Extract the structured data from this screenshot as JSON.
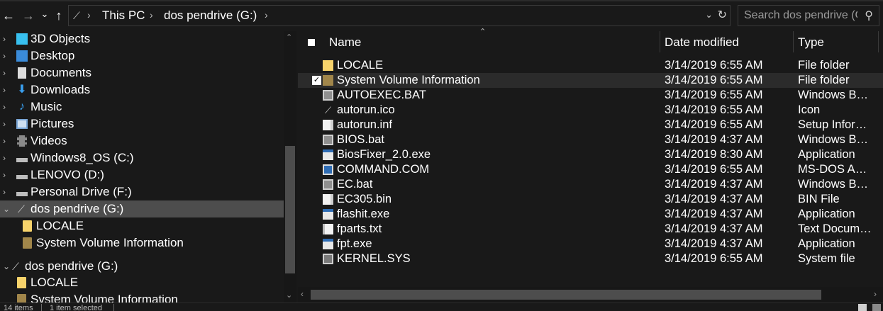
{
  "toolbar": {
    "back_glyph": "←",
    "forward_glyph": "→",
    "recent_glyph": "⌄",
    "up_glyph": "↑"
  },
  "address": {
    "breadcrumbs": [
      "This PC",
      "dos pendrive (G:)"
    ],
    "separator": "›",
    "dropdown_glyph": "⌄",
    "refresh_glyph": "↻"
  },
  "search": {
    "placeholder": "Search dos pendrive (G:)",
    "icon": "search-icon",
    "glyph": "⚲"
  },
  "nav": {
    "items": [
      {
        "label": "3D Objects",
        "icon": "3d-objects-icon"
      },
      {
        "label": "Desktop",
        "icon": "desktop-icon"
      },
      {
        "label": "Documents",
        "icon": "documents-icon"
      },
      {
        "label": "Downloads",
        "icon": "downloads-icon"
      },
      {
        "label": "Music",
        "icon": "music-icon"
      },
      {
        "label": "Pictures",
        "icon": "pictures-icon"
      },
      {
        "label": "Videos",
        "icon": "videos-icon"
      },
      {
        "label": "Windows8_OS (C:)",
        "icon": "drive-icon"
      },
      {
        "label": "LENOVO (D:)",
        "icon": "drive-icon"
      },
      {
        "label": "Personal Drive (F:)",
        "icon": "drive-icon"
      },
      {
        "label": "dos pendrive (G:)",
        "icon": "usb-drive-icon",
        "selected": true
      },
      {
        "label": "LOCALE",
        "icon": "folder-icon"
      },
      {
        "label": "System Volume Information",
        "icon": "folder-icon"
      },
      {
        "label": "dos pendrive (G:)",
        "icon": "usb-drive-icon"
      },
      {
        "label": "LOCALE",
        "icon": "folder-icon"
      },
      {
        "label": "System Volume Information",
        "icon": "folder-icon"
      }
    ],
    "collapsed_glyph": "›",
    "expanded_glyph": "⌄"
  },
  "columns": {
    "name": "Name",
    "date": "Date modified",
    "type": "Type"
  },
  "files": [
    {
      "name": "LOCALE",
      "date": "3/14/2019 6:55 AM",
      "type": "File folder",
      "icon": "folder-icon"
    },
    {
      "name": "System Volume Information",
      "date": "3/14/2019 6:55 AM",
      "type": "File folder",
      "icon": "folder-icon",
      "checked": true
    },
    {
      "name": "AUTOEXEC.BAT",
      "date": "3/14/2019 6:55 AM",
      "type": "Windows Batch File",
      "icon": "batch-file-icon"
    },
    {
      "name": "autorun.ico",
      "date": "3/14/2019 6:55 AM",
      "type": "Icon",
      "icon": "icon-file-icon"
    },
    {
      "name": "autorun.inf",
      "date": "3/14/2019 6:55 AM",
      "type": "Setup Information",
      "icon": "setup-info-icon"
    },
    {
      "name": "BIOS.bat",
      "date": "3/14/2019 4:37 AM",
      "type": "Windows Batch File",
      "icon": "batch-file-icon"
    },
    {
      "name": "BiosFixer_2.0.exe",
      "date": "3/14/2019 8:30 AM",
      "type": "Application",
      "icon": "application-icon"
    },
    {
      "name": "COMMAND.COM",
      "date": "3/14/2019 6:55 AM",
      "type": "MS-DOS Application",
      "icon": "msdos-app-icon"
    },
    {
      "name": "EC.bat",
      "date": "3/14/2019 4:37 AM",
      "type": "Windows Batch File",
      "icon": "batch-file-icon"
    },
    {
      "name": "EC305.bin",
      "date": "3/14/2019 4:37 AM",
      "type": "BIN File",
      "icon": "blank-file-icon"
    },
    {
      "name": "flashit.exe",
      "date": "3/14/2019 4:37 AM",
      "type": "Application",
      "icon": "application-icon"
    },
    {
      "name": "fparts.txt",
      "date": "3/14/2019 4:37 AM",
      "type": "Text Document",
      "icon": "text-file-icon"
    },
    {
      "name": "fpt.exe",
      "date": "3/14/2019 4:37 AM",
      "type": "Application",
      "icon": "application-icon"
    },
    {
      "name": "KERNEL.SYS",
      "date": "3/14/2019 6:55 AM",
      "type": "System file",
      "icon": "system-file-icon"
    }
  ],
  "status": {
    "item_count": "14 items",
    "selection": "1 item selected"
  },
  "colors": {
    "background": "#191919",
    "selected": "#4d4d4d",
    "hover": "#2b2b2b",
    "folder": "#f7d36b",
    "accent": "#3aa0f0"
  }
}
